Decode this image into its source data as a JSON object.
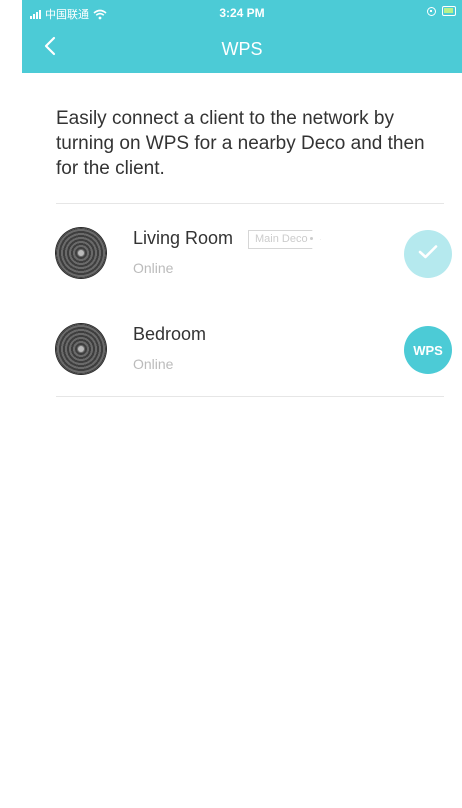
{
  "status_bar": {
    "carrier": "中国联通",
    "time": "3:24 PM"
  },
  "nav": {
    "title": "WPS"
  },
  "description": "Easily connect a client to the network by turning on WPS for a nearby Deco and then for the client.",
  "decos": [
    {
      "name": "Living Room",
      "badge": "Main Deco",
      "status": "Online",
      "action": "check-icon"
    },
    {
      "name": "Bedroom",
      "status": "Online",
      "action_label": "WPS"
    }
  ],
  "colors": {
    "accent": "#4ccbd6",
    "accent_light": "#b5e9ee",
    "text": "#333333",
    "muted": "#bbbbbb"
  }
}
